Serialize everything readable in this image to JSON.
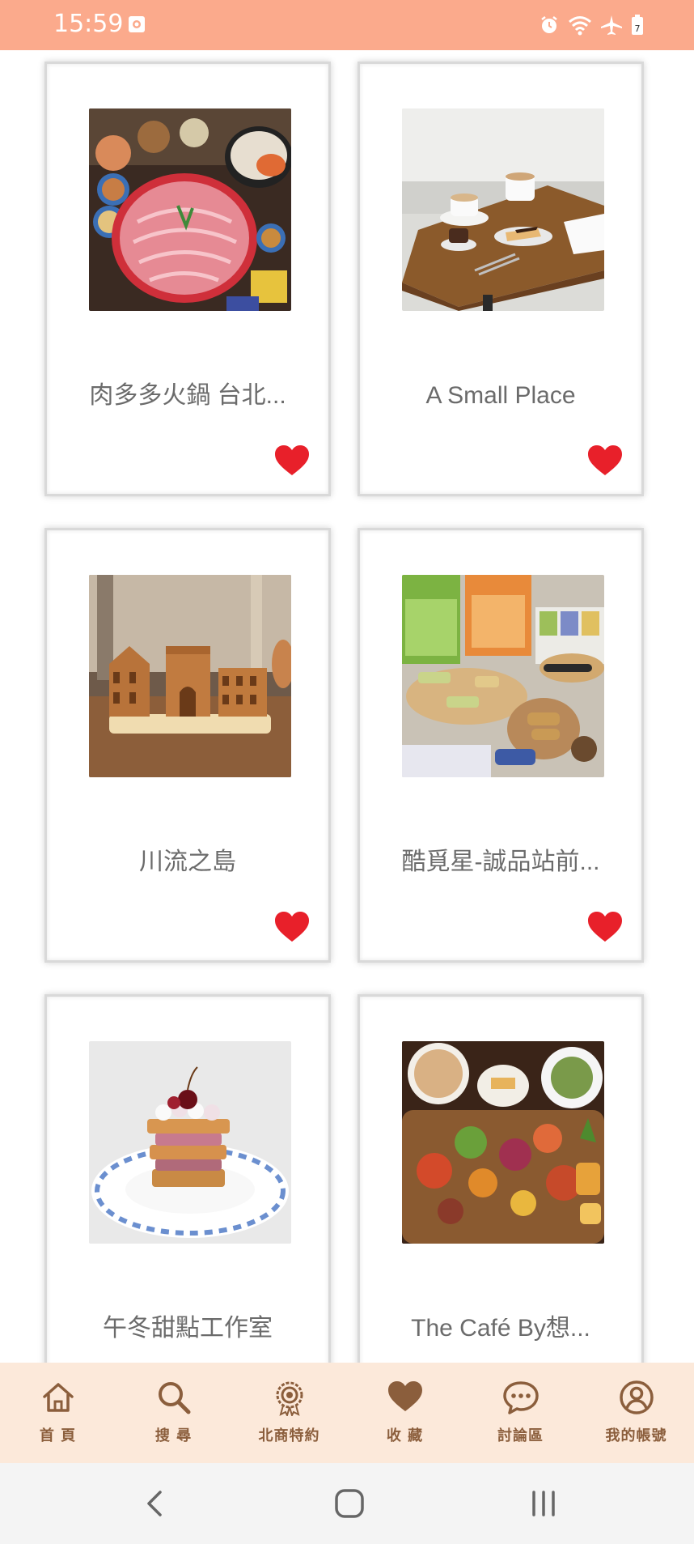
{
  "status_bar": {
    "time": "15:59",
    "icons": [
      "notification-icon",
      "alarm-icon",
      "wifi-icon",
      "airplane-icon",
      "battery-icon"
    ]
  },
  "cards": [
    {
      "name": "肉多多火鍋 台北...",
      "photo": "hotpot-photo",
      "favorited": true
    },
    {
      "name": "A Small Place",
      "photo": "cafe-table-photo",
      "favorited": true
    },
    {
      "name": "川流之島",
      "photo": "building-pastry-photo",
      "favorited": true
    },
    {
      "name": "酷覓星-誠品站前...",
      "photo": "egg-roll-snacks-photo",
      "favorited": true
    },
    {
      "name": "午冬甜點工作室",
      "photo": "mille-feuille-photo",
      "favorited": true
    },
    {
      "name": "The Café By想...",
      "photo": "platter-photo",
      "favorited": true
    }
  ],
  "bottom_nav": [
    {
      "label": "首 頁",
      "icon": "home-icon"
    },
    {
      "label": "搜 尋",
      "icon": "search-icon"
    },
    {
      "label": "北商特約",
      "icon": "badge-icon"
    },
    {
      "label": "收 藏",
      "icon": "heart-icon"
    },
    {
      "label": "討論區",
      "icon": "chat-icon"
    },
    {
      "label": "我的帳號",
      "icon": "account-icon"
    }
  ],
  "system_nav": [
    "back-icon",
    "home-circle-icon",
    "recents-icon"
  ],
  "colors": {
    "status_bar": "#FBAA8C",
    "nav_background": "#FCE9DA",
    "nav_accent": "#8B5E3C",
    "heart": "#E8202A",
    "card_text": "#6b6b6b"
  }
}
